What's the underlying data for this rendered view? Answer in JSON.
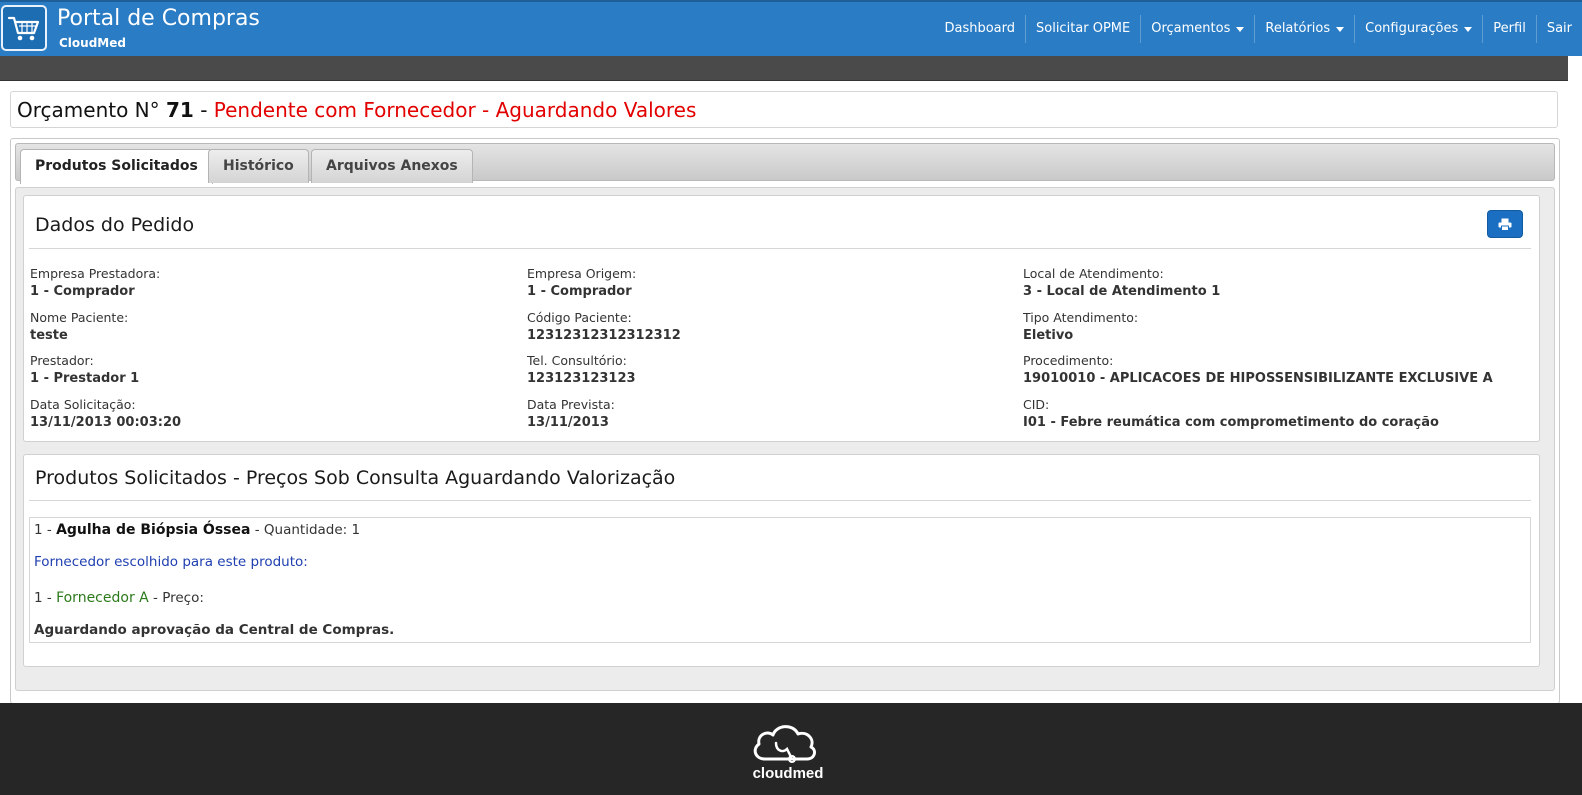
{
  "brand": {
    "title": "Portal de Compras",
    "subtitle": "CloudMed",
    "icon": "cart-icon"
  },
  "nav": {
    "items": [
      {
        "label": "Dashboard",
        "dropdown": false
      },
      {
        "label": "Solicitar OPME",
        "dropdown": false
      },
      {
        "label": "Orçamentos",
        "dropdown": true
      },
      {
        "label": "Relatórios",
        "dropdown": true
      },
      {
        "label": "Configurações",
        "dropdown": true
      },
      {
        "label": "Perfil",
        "dropdown": false
      },
      {
        "label": "Sair",
        "dropdown": false
      }
    ]
  },
  "header": {
    "prefix": "Orçamento N°",
    "number": "71",
    "separator": "-",
    "status": "Pendente com Fornecedor - Aguardando Valores",
    "status_color": "#e20000"
  },
  "tabs": [
    {
      "label": "Produtos Solicitados",
      "active": true
    },
    {
      "label": "Histórico",
      "active": false
    },
    {
      "label": "Arquivos Anexos",
      "active": false
    }
  ],
  "order": {
    "title": "Dados do Pedido",
    "print_icon": "print-icon",
    "fields": [
      {
        "label": "Empresa Prestadora:",
        "value": "1 - Comprador"
      },
      {
        "label": "Empresa Origem:",
        "value": "1 - Comprador"
      },
      {
        "label": "Local de Atendimento:",
        "value": "3 - Local de Atendimento 1"
      },
      {
        "label": "Nome Paciente:",
        "value": "teste"
      },
      {
        "label": "Código Paciente:",
        "value": "12312312312312312"
      },
      {
        "label": "Tipo Atendimento:",
        "value": "Eletivo"
      },
      {
        "label": "Prestador:",
        "value": "1 - Prestador 1"
      },
      {
        "label": "Tel. Consultório:",
        "value": "123123123123"
      },
      {
        "label": "Procedimento:",
        "value": "19010010 - APLICACOES DE HIPOSSENSIBILIZANTE EXCLUSIVE A"
      },
      {
        "label": "Data Solicitação:",
        "value": "13/11/2013 00:03:20"
      },
      {
        "label": "Data Prevista:",
        "value": "13/11/2013"
      },
      {
        "label": "CID:",
        "value": "I01 - Febre reumática com comprometimento do coração"
      }
    ]
  },
  "products": {
    "title": "Produtos Solicitados - Preços Sob Consulta Aguardando Valorização",
    "items": [
      {
        "index": "1 -",
        "name": "Agulha de Biópsia Óssea",
        "quantity_label": "- Quantidade: 1",
        "supplier_heading": "Fornecedor escolhido para este produto:",
        "supplier_index": "1 -",
        "supplier_name": "Fornecedor A",
        "price_label": "- Preço:",
        "status": "Aguardando aprovação da Central de Compras."
      }
    ]
  },
  "footer": {
    "logo_text": "cloudmed",
    "logo_icon": "cloud-stethoscope-icon"
  },
  "colors": {
    "navbar": "#2a7cc5",
    "print_button": "#1b6fc2",
    "supplier_heading": "#1f3fb0",
    "supplier_name": "#2b7a1a"
  }
}
